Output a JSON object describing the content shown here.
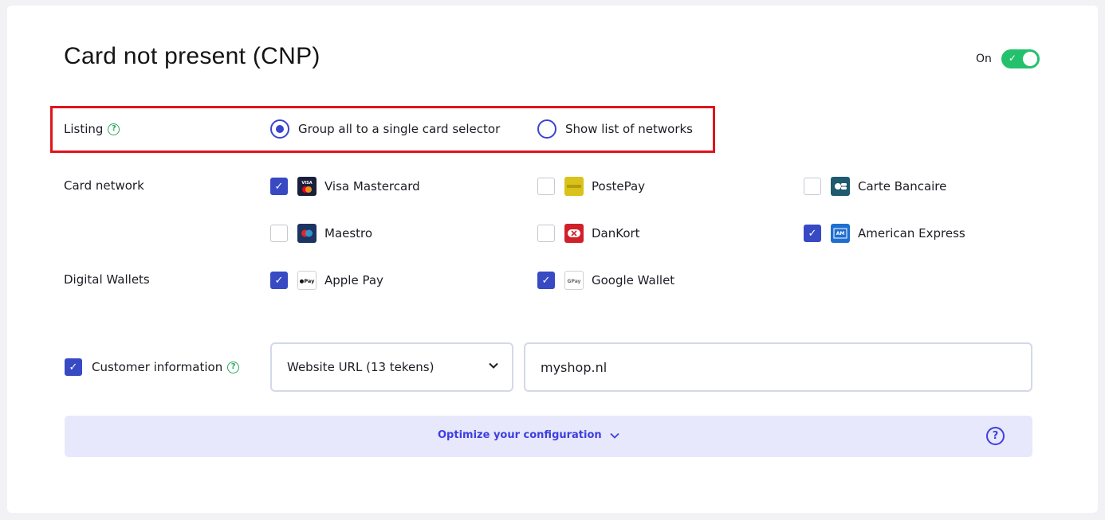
{
  "header": {
    "title": "Card not present (CNP)",
    "toggle_label": "On",
    "toggle_on": true
  },
  "listing": {
    "label": "Listing",
    "help_icon": "?",
    "options": [
      {
        "label": "Group all to a single card selector",
        "selected": true
      },
      {
        "label": "Show list of networks",
        "selected": false
      }
    ]
  },
  "card_network": {
    "label": "Card network",
    "items": [
      {
        "label": "Visa Mastercard",
        "checked": true,
        "icon": "visa-mastercard-icon"
      },
      {
        "label": "PostePay",
        "checked": false,
        "icon": "postepay-icon"
      },
      {
        "label": "Carte Bancaire",
        "checked": false,
        "icon": "carte-bancaire-icon"
      },
      {
        "label": "Maestro",
        "checked": false,
        "icon": "maestro-icon"
      },
      {
        "label": "DanKort",
        "checked": false,
        "icon": "dankort-icon"
      },
      {
        "label": "American Express",
        "checked": true,
        "icon": "amex-icon"
      }
    ]
  },
  "digital_wallets": {
    "label": "Digital Wallets",
    "items": [
      {
        "label": "Apple Pay",
        "checked": true,
        "icon": "apple-pay-icon"
      },
      {
        "label": "Google Wallet",
        "checked": true,
        "icon": "google-pay-icon"
      }
    ]
  },
  "customer_info": {
    "label": "Customer information",
    "checked": true,
    "help_icon": "?",
    "select_value": "Website URL (13 tekens)",
    "input_value": "myshop.nl"
  },
  "optimize": {
    "label": "Optimize your configuration",
    "help_icon": "?"
  },
  "colors": {
    "accent": "#3849c4",
    "toggle_on": "#23c16b",
    "highlight": "#e0141b",
    "optimize_bg": "#e7e8fb",
    "optimize_text": "#3e3ee0"
  }
}
